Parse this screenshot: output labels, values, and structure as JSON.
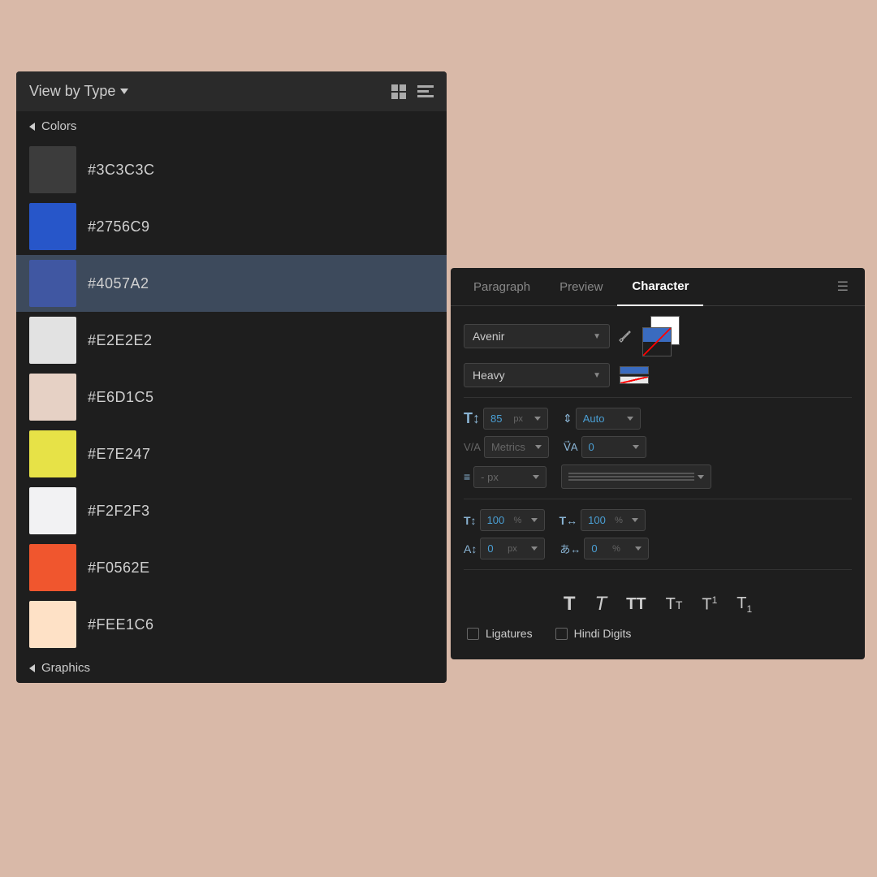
{
  "background_color": "#d9b9a8",
  "left_panel": {
    "header": {
      "view_by_type_label": "View by Type",
      "grid_icon_name": "grid-icon",
      "list_icon_name": "list-icon"
    },
    "colors_section": {
      "label": "Colors",
      "items": [
        {
          "hex": "#3C3C3C",
          "label": "#3C3C3C",
          "selected": false
        },
        {
          "hex": "#2756C9",
          "label": "#2756C9",
          "selected": false
        },
        {
          "hex": "#4057A2",
          "label": "#4057A2",
          "selected": true
        },
        {
          "hex": "#E2E2E2",
          "label": "#E2E2E2",
          "selected": false
        },
        {
          "hex": "#E6D1C5",
          "label": "#E6D1C5",
          "selected": false
        },
        {
          "hex": "#E7E247",
          "label": "#E7E247",
          "selected": false
        },
        {
          "hex": "#F2F2F3",
          "label": "#F2F2F3",
          "selected": false
        },
        {
          "hex": "#F0562E",
          "label": "#F0562E",
          "selected": false
        },
        {
          "hex": "#FEE1C6",
          "label": "#FEE1C6",
          "selected": false
        }
      ]
    },
    "graphics_section": {
      "label": "Graphics"
    }
  },
  "right_panel": {
    "tabs": [
      {
        "label": "Paragraph",
        "active": false
      },
      {
        "label": "Preview",
        "active": false
      },
      {
        "label": "Character",
        "active": true
      }
    ],
    "font_family": "Avenir",
    "font_weight": "Heavy",
    "font_size_value": "85",
    "font_size_unit": "px",
    "leading_label": "Auto",
    "tracking_label": "Metrics",
    "tracking_value": "0",
    "indent_value": "- px",
    "scale_v_value": "100",
    "scale_v_unit": "%",
    "scale_h_value": "100",
    "scale_h_unit": "%",
    "baseline_value": "0",
    "baseline_unit": "px",
    "tsume_value": "0",
    "tsume_unit": "%",
    "text_styles": [
      "T",
      "T",
      "TT",
      "Tt",
      "T",
      "T"
    ],
    "ligatures_label": "Ligatures",
    "hindi_digits_label": "Hindi Digits"
  }
}
